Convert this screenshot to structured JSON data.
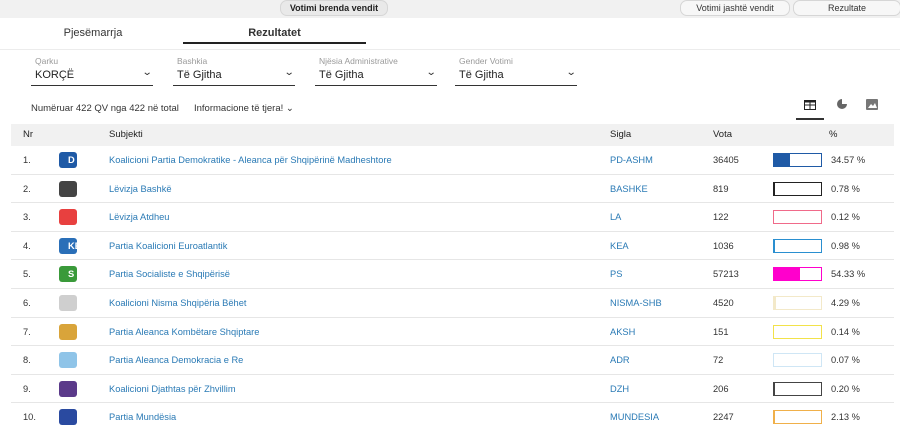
{
  "top_buttons": {
    "inside": "Votimi brenda vendit",
    "outside": "Votimi jashtë vendit",
    "results": "Rezultate"
  },
  "tabs": {
    "ballot": "Pjesëmarrja",
    "results": "Rezultatet"
  },
  "filters": [
    {
      "label": "Qarku",
      "value": "KORÇË"
    },
    {
      "label": "Bashkia",
      "value": "Të Gjitha"
    },
    {
      "label": "Njësia Administrative",
      "value": "Të Gjitha"
    },
    {
      "label": "Gender Votimi",
      "value": "Të Gjitha"
    }
  ],
  "summary": {
    "counted": "Numëruar 422 QV nga 422 në total",
    "more_info": "Informacione të tjera!"
  },
  "view_icons": [
    "table-icon",
    "pie-chart-icon",
    "image-icon"
  ],
  "table": {
    "headers": {
      "nr": "Nr",
      "subject": "Subjekti",
      "sigla": "Sigla",
      "votes": "Vota",
      "pct": "%"
    },
    "rows": [
      {
        "nr": "1.",
        "subject": "Koalicioni Partia Demokratike - Aleanca për Shqipërinë Madheshtore",
        "sigla": "PD-ASHM",
        "votes": "36405",
        "pct": "34.57 %",
        "share": 0.3457,
        "color": "#1f5aa6",
        "logo_bg": "#1f5aa6",
        "logo_text": "D"
      },
      {
        "nr": "2.",
        "subject": "Lëvizja Bashkë",
        "sigla": "BASHKE",
        "votes": "819",
        "pct": "0.78 %",
        "share": 0.0078,
        "color": "#222222",
        "logo_bg": "#444444",
        "logo_text": ""
      },
      {
        "nr": "3.",
        "subject": "Lëvizja Atdheu",
        "sigla": "LA",
        "votes": "122",
        "pct": "0.12 %",
        "share": 0.0012,
        "color": "#f06a8a",
        "logo_bg": "#e8403f",
        "logo_text": ""
      },
      {
        "nr": "4.",
        "subject": "Partia Koalicioni Euroatlantik",
        "sigla": "KEA",
        "votes": "1036",
        "pct": "0.98 %",
        "share": 0.0098,
        "color": "#2a8fd0",
        "logo_bg": "#2a6fb8",
        "logo_text": "KEA"
      },
      {
        "nr": "5.",
        "subject": "Partia Socialiste e Shqipërisë",
        "sigla": "PS",
        "votes": "57213",
        "pct": "54.33 %",
        "share": 0.5433,
        "color": "#ff00cc",
        "logo_bg": "#3a9a3a",
        "logo_text": "S"
      },
      {
        "nr": "6.",
        "subject": "Koalicioni Nisma Shqipëria Bëhet",
        "sigla": "NISMA-SHB",
        "votes": "4520",
        "pct": "4.29 %",
        "share": 0.0429,
        "color": "#f3e9c9",
        "logo_bg": "#cfcfcf",
        "logo_text": ""
      },
      {
        "nr": "7.",
        "subject": "Partia Aleanca Kombëtare Shqiptare",
        "sigla": "AKSH",
        "votes": "151",
        "pct": "0.14 %",
        "share": 0.0014,
        "color": "#f2e24a",
        "logo_bg": "#d9a43a",
        "logo_text": ""
      },
      {
        "nr": "8.",
        "subject": "Partia Aleanca Demokracia e Re",
        "sigla": "ADR",
        "votes": "72",
        "pct": "0.07 %",
        "share": 0.0007,
        "color": "#cfe6f5",
        "logo_bg": "#8fc4e8",
        "logo_text": ""
      },
      {
        "nr": "9.",
        "subject": "Koalicioni Djathtas për Zhvillim",
        "sigla": "DZH",
        "votes": "206",
        "pct": "0.20 %",
        "share": 0.002,
        "color": "#444444",
        "logo_bg": "#5b3a8a",
        "logo_text": ""
      },
      {
        "nr": "10.",
        "subject": "Partia Mundësia",
        "sigla": "MUNDESIA",
        "votes": "2247",
        "pct": "2.13 %",
        "share": 0.0213,
        "color": "#f0b04a",
        "logo_bg": "#2a4aa0",
        "logo_text": ""
      }
    ]
  }
}
